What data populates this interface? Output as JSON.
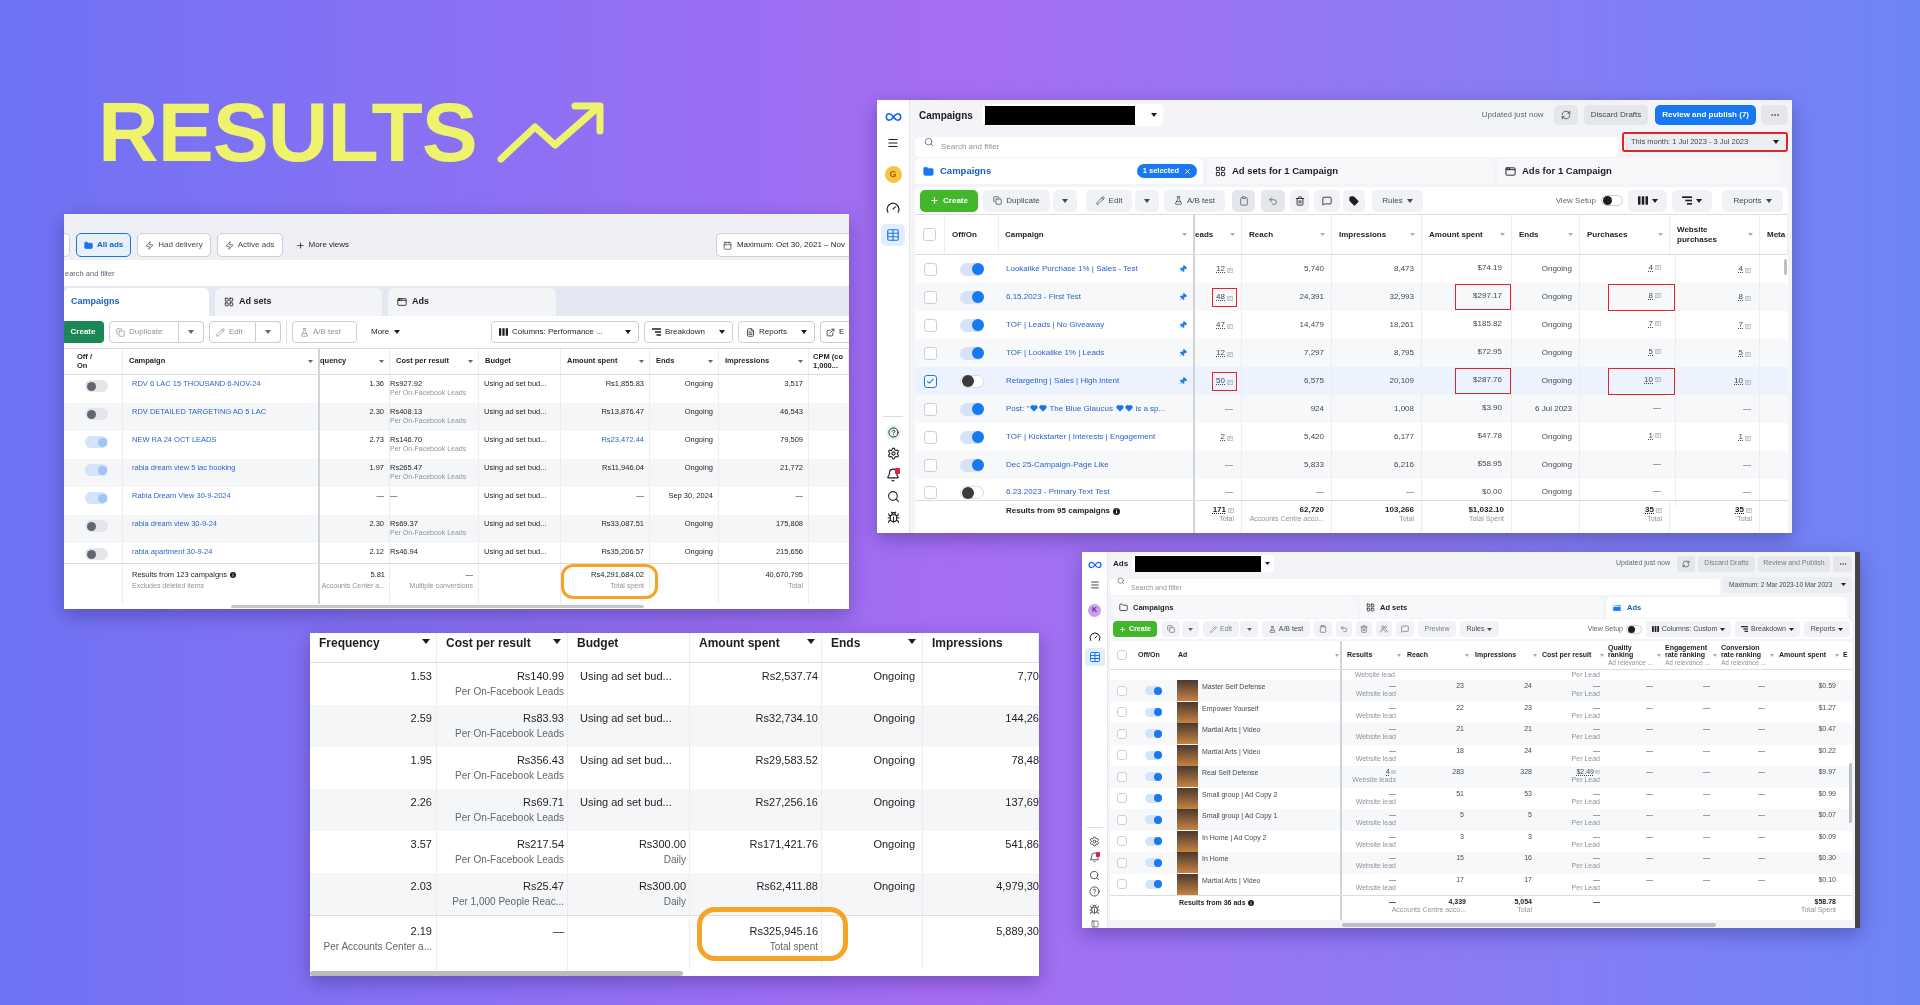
{
  "title": {
    "text": "RESULTS"
  },
  "left_screenshot": {
    "views": [
      {
        "label": "All ads",
        "kind": "folder",
        "selected": true
      },
      {
        "label": "Had delivery",
        "kind": "bolt",
        "selected": false
      },
      {
        "label": "Active ads",
        "kind": "bolt",
        "selected": false
      },
      {
        "label": "More views",
        "kind": "plus",
        "selected": false
      }
    ],
    "date_range": "Maximum: Oct 30, 2021 – Nov",
    "search": {
      "placeholder": "earch and filter"
    },
    "tabs": [
      {
        "label": "Campaigns",
        "selected": true
      },
      {
        "label": "Ad sets",
        "selected": false
      },
      {
        "label": "Ads",
        "selected": false
      }
    ],
    "toolbar": {
      "create": "Create",
      "duplicate": {
        "label": "Duplicate",
        "disabled": true
      },
      "edit": {
        "label": "Edit",
        "disabled": true
      },
      "ab_test": {
        "label": "A/B test",
        "disabled": true
      },
      "more": "More",
      "columns": "Columns: Performance ...",
      "breakdown": "Breakdown",
      "reports": "Reports",
      "export": "E"
    },
    "columns": [
      {
        "label": "Off / On",
        "sortable": false
      },
      {
        "label": "Campaign",
        "sortable": true
      },
      {
        "label": "quency",
        "sortable": true
      },
      {
        "label": "Cost per result",
        "sortable": true
      },
      {
        "label": "Budget",
        "sortable": false
      },
      {
        "label": "Amount spent",
        "sortable": true
      },
      {
        "label": "Ends",
        "sortable": true
      },
      {
        "label": "Impressions",
        "sortable": true
      },
      {
        "label": "CPM (co 1,000...",
        "sortable": false
      }
    ],
    "rows": [
      {
        "on": false,
        "campaign": "RDV 6 LAC 15 THOUSAND 6-NOV-24",
        "frequency": "1.36",
        "cost_per_result": "Rs927.92",
        "cost_note": "Per On-Facebook Leads",
        "budget": "Using ad set bud...",
        "amount_spent": "Rs1,855.83",
        "amount_linked": false,
        "ends": "Ongoing",
        "impressions": "3,517"
      },
      {
        "on": false,
        "campaign": "RDV DETAILED TARGETING AD 5 LAC",
        "frequency": "2.30",
        "cost_per_result": "Rs408.13",
        "cost_note": "Per On-Facebook Leads",
        "budget": "Using ad set bud...",
        "amount_spent": "Rs13,876.47",
        "amount_linked": false,
        "ends": "Ongoing",
        "impressions": "46,543"
      },
      {
        "on": true,
        "campaign": "NEW RA 24 OCT LEADS",
        "frequency": "2.73",
        "cost_per_result": "Rs146.70",
        "cost_note": "Per On-Facebook Leads",
        "budget": "Using ad set bud...",
        "amount_spent": "Rs23,472.44",
        "amount_linked": true,
        "ends": "Ongoing",
        "impressions": "79,509"
      },
      {
        "on": true,
        "campaign": "rabia dream view 5 lac booking",
        "frequency": "1.97",
        "cost_per_result": "Rs265.47",
        "cost_note": "Per On-Facebook Leads",
        "budget": "Using ad set bud...",
        "amount_spent": "Rs11,946.04",
        "amount_linked": false,
        "ends": "Ongoing",
        "impressions": "21,772"
      },
      {
        "on": true,
        "campaign": "Rabia Dream View 30-9-2024",
        "frequency": "—",
        "cost_per_result": "—",
        "budget": "Using ad set bud...",
        "amount_spent": "—",
        "amount_linked": false,
        "ends": "Sep 30, 2024",
        "impressions": "—"
      },
      {
        "on": false,
        "campaign": "rabia dream view 30-9-24",
        "frequency": "2.30",
        "cost_per_result": "Rs69.37",
        "cost_note": "Per On-Facebook Leads",
        "budget": "Using ad set bud...",
        "amount_spent": "Rs33,087.51",
        "amount_linked": false,
        "ends": "Ongoing",
        "impressions": "175,808"
      },
      {
        "on": false,
        "campaign": "rabia apartment 30-9-24",
        "frequency": "2.12",
        "cost_per_result": "Rs46.94",
        "budget": "Using ad set bud...",
        "amount_spent": "Rs35,206.57",
        "amount_linked": false,
        "ends": "Ongoing",
        "impressions": "215,656"
      }
    ],
    "footer": {
      "label": "Results from 123 campaigns",
      "note": "Excludes deleted items",
      "frequency": "5.81",
      "frequency_note": "Accounts Center a...",
      "cost_per_result": "—",
      "cost_note": "Multiple conversions",
      "amount_spent": "Rs4,291,684.02",
      "amount_note": "Total spent",
      "circled": true,
      "impressions": "40,670,795",
      "impressions_note": "Total"
    }
  },
  "top_right_screenshot": {
    "avatar": "G",
    "page_title": "Campaigns",
    "status": "Updated just now",
    "discard": {
      "label": "Discard Drafts",
      "disabled": false
    },
    "publish": {
      "label": "Review and publish (7)",
      "disabled": false
    },
    "search": {
      "placeholder": "Search and filter"
    },
    "date_range": {
      "text": "This month: 1 Jul 2023 - 3 Jul 2023",
      "boxed": true
    },
    "tabs": [
      {
        "label": "Campaigns",
        "selected": true,
        "chip": "1 selected"
      },
      {
        "label": "Ad sets for 1 Campaign",
        "selected": false
      },
      {
        "label": "Ads for 1 Campaign",
        "selected": false
      }
    ],
    "toolbar": {
      "create": "Create",
      "duplicate": {
        "label": "Duplicate",
        "disabled": false
      },
      "edit": {
        "label": "Edit",
        "disabled": false
      },
      "ab_test": {
        "label": "A/B test",
        "disabled": false
      },
      "rules": "Rules",
      "view_setup": {
        "label": "View Setup",
        "on": false
      },
      "reports": "Reports"
    },
    "select_all_checked": false,
    "columns": [
      {
        "label": "Off/On",
        "sortable": false
      },
      {
        "label": "Campaign",
        "sortable": true
      },
      {
        "label": "eads",
        "sortable": true
      },
      {
        "label": "Reach",
        "sortable": true
      },
      {
        "label": "Impressions",
        "sortable": true
      },
      {
        "label": "Amount spent",
        "sortable": true
      },
      {
        "label": "Ends",
        "sortable": true
      },
      {
        "label": "Purchases",
        "sortable": true
      },
      {
        "label": "Website purchases",
        "sortable": true
      },
      {
        "label": "Meta",
        "sortable": false
      }
    ],
    "rows": [
      {
        "selected": false,
        "on": true,
        "campaign": "Lookalike Purchase 1% | Sales - Test",
        "pinned": true,
        "leads": "12",
        "reach": "5,740",
        "impressions": "8,473",
        "amount_spent": "$74.19",
        "ends": "Ongoing",
        "purchases": "4",
        "website_purchases": "4",
        "attribution_icons": true,
        "boxed": false
      },
      {
        "selected": false,
        "on": true,
        "campaign": "6.15.2023 - First Test",
        "pinned": true,
        "leads": "48",
        "reach": "24,391",
        "impressions": "32,993",
        "amount_spent": "$297.17",
        "ends": "Ongoing",
        "purchases": "8",
        "website_purchases": "8",
        "attribution_icons": true,
        "boxed": true
      },
      {
        "selected": false,
        "on": true,
        "campaign": "TOF | Leads | No Giveaway",
        "pinned": true,
        "leads": "47",
        "reach": "14,479",
        "impressions": "18,261",
        "amount_spent": "$185.82",
        "ends": "Ongoing",
        "purchases": "7",
        "website_purchases": "7",
        "attribution_icons": true,
        "boxed": false
      },
      {
        "selected": false,
        "on": true,
        "campaign": "TOF | Lookalike 1% | Leads",
        "pinned": true,
        "leads": "12",
        "reach": "7,297",
        "impressions": "8,795",
        "amount_spent": "$72.95",
        "ends": "Ongoing",
        "purchases": "5",
        "website_purchases": "5",
        "attribution_icons": true,
        "boxed": false
      },
      {
        "selected": true,
        "on": false,
        "campaign": "Retargeting | Sales | High Intent",
        "pinned": true,
        "leads": "50",
        "reach": "6,575",
        "impressions": "20,109",
        "amount_spent": "$287.76",
        "ends": "Ongoing",
        "purchases": "10",
        "website_purchases": "10",
        "attribution_icons": true,
        "boxed": true
      },
      {
        "selected": false,
        "on": true,
        "campaign_parts": [
          {
            "kind": "text",
            "text": "Post: \""
          },
          {
            "kind": "heart"
          },
          {
            "kind": "heart"
          },
          {
            "kind": "text",
            "text": " The Blue Glaucus "
          },
          {
            "kind": "heart"
          },
          {
            "kind": "heart"
          },
          {
            "kind": "text",
            "text": " is a sp..."
          }
        ],
        "pinned": false,
        "leads": "—",
        "reach": "924",
        "impressions": "1,008",
        "amount_spent": "$3.90",
        "ends": "6 Jul 2023",
        "purchases": "—",
        "website_purchases": "—",
        "attribution_icons": false,
        "boxed": false
      },
      {
        "selected": false,
        "on": true,
        "campaign": "TOF | Kickstarter | Interests | Engagement",
        "pinned": false,
        "leads": "2",
        "reach": "5,420",
        "impressions": "6,177",
        "amount_spent": "$47.78",
        "ends": "Ongoing",
        "purchases": "1",
        "website_purchases": "1",
        "attribution_icons": true,
        "boxed": false
      },
      {
        "selected": false,
        "on": true,
        "campaign": "Dec 25-Campaign-Page Like",
        "pinned": false,
        "leads": "—",
        "reach": "5,833",
        "impressions": "6,216",
        "amount_spent": "$58.95",
        "ends": "Ongoing",
        "purchases": "—",
        "website_purchases": "—",
        "attribution_icons": false,
        "boxed": false
      },
      {
        "selected": false,
        "on": false,
        "campaign": "6.23.2023 - Primary Text Test",
        "pinned": false,
        "leads": "—",
        "reach": "—",
        "impressions": "—",
        "amount_spent": "$0.00",
        "ends": "Ongoing",
        "purchases": "—",
        "website_purchases": "—",
        "attribution_icons": false,
        "boxed": false
      }
    ],
    "footer": {
      "label": "Results from 95 campaigns",
      "leads": "171",
      "leads_note": "Total",
      "reach": "62,720",
      "reach_note": "Accounts Centre acco...",
      "impressions": "103,266",
      "impressions_note": "Total",
      "amount_spent": "$1,032.10",
      "amount_note": "Total Spent",
      "purchases": "35",
      "purchases_note": "Total",
      "website_purchases": "35",
      "website_purchases_note": "Total"
    }
  },
  "bottom_screenshot": {
    "columns": [
      {
        "label": "Frequency",
        "sortable": true
      },
      {
        "label": "Cost per result",
        "sortable": true
      },
      {
        "label": "Budget",
        "sortable": false
      },
      {
        "label": "Amount spent",
        "sortable": true
      },
      {
        "label": "Ends",
        "sortable": true
      },
      {
        "label": "Impressions",
        "sortable": false
      }
    ],
    "rows": [
      {
        "frequency": "1.53",
        "cost_per_result": "Rs140.99",
        "cost_note": "Per On-Facebook Leads",
        "budget": {
          "kind": "ad_set",
          "text": "Using ad set bud..."
        },
        "amount_spent": "Rs2,537.74",
        "ends": "Ongoing",
        "impressions": "7,70"
      },
      {
        "frequency": "2.59",
        "cost_per_result": "Rs83.93",
        "cost_note": "Per On-Facebook Leads",
        "budget": {
          "kind": "ad_set",
          "text": "Using ad set bud..."
        },
        "amount_spent": "Rs32,734.10",
        "ends": "Ongoing",
        "impressions": "144,26"
      },
      {
        "frequency": "1.95",
        "cost_per_result": "Rs356.43",
        "cost_note": "Per On-Facebook Leads",
        "budget": {
          "kind": "ad_set",
          "text": "Using ad set bud..."
        },
        "amount_spent": "Rs29,583.52",
        "ends": "Ongoing",
        "impressions": "78,48"
      },
      {
        "frequency": "2.26",
        "cost_per_result": "Rs69.71",
        "cost_note": "Per On-Facebook Leads",
        "budget": {
          "kind": "ad_set",
          "text": "Using ad set bud..."
        },
        "amount_spent": "Rs27,256.16",
        "ends": "Ongoing",
        "impressions": "137,69"
      },
      {
        "frequency": "3.57",
        "cost_per_result": "Rs217.54",
        "cost_note": "Per On-Facebook Leads",
        "budget": {
          "kind": "daily",
          "text": "Rs300.00",
          "note": "Daily"
        },
        "amount_spent": "Rs171,421.76",
        "ends": "Ongoing",
        "impressions": "541,86"
      },
      {
        "frequency": "2.03",
        "cost_per_result": "Rs25.47",
        "cost_note": "Per 1,000 People Reac...",
        "budget": {
          "kind": "daily",
          "text": "Rs300.00",
          "note": "Daily"
        },
        "amount_spent": "Rs62,411.88",
        "ends": "Ongoing",
        "impressions": "4,979,30"
      }
    ],
    "footer": {
      "frequency": "2.19",
      "frequency_note": "Per Accounts Center a...",
      "cost_per_result": "—",
      "amount_spent": "Rs325,945.16",
      "amount_note": "Total spent",
      "circled": true,
      "impressions": "5,889,30"
    }
  },
  "bottom_right_screenshot": {
    "avatar": "K",
    "page_title": "Ads",
    "status": "Updated just now",
    "discard": {
      "label": "Discard Drafts",
      "disabled": true
    },
    "publish": {
      "label": "Review and Publish",
      "disabled": true
    },
    "search": {
      "placeholder": "Search and filter"
    },
    "date_range": {
      "text": "Maximum: 2 Mar 2023-10 Mar 2023",
      "boxed": false
    },
    "tabs": [
      {
        "label": "Campaigns",
        "selected": false
      },
      {
        "label": "Ad sets",
        "selected": false
      },
      {
        "label": "Ads",
        "selected": true
      }
    ],
    "toolbar": {
      "create": "Create",
      "edit": {
        "label": "Edit",
        "disabled": true
      },
      "ab_test": {
        "label": "A/B test",
        "disabled": false
      },
      "preview": {
        "label": "Preview",
        "disabled": true
      },
      "rules": "Rules",
      "view_setup": {
        "label": "View Setup",
        "on": false
      },
      "columns": "Columns: Custom",
      "breakdown": "Breakdown",
      "reports": "Reports"
    },
    "select_all_checked": false,
    "columns": [
      {
        "label": "Off/On",
        "sortable": false
      },
      {
        "label": "Ad",
        "sortable": true
      },
      {
        "label": "Results",
        "sortable": true
      },
      {
        "label": "Reach",
        "sortable": true
      },
      {
        "label": "Impressions",
        "sortable": true
      },
      {
        "label": "Cost per result",
        "sortable": true
      },
      {
        "label": "Quality ranking",
        "note": "Ad relevance ...",
        "sortable": true
      },
      {
        "label": "Engagement rate ranking",
        "note": "Ad relevance ...",
        "sortable": true
      },
      {
        "label": "Conversion rate ranking",
        "note": "Ad relevance ...",
        "sortable": true
      },
      {
        "label": "Amount spent",
        "sortable": true
      },
      {
        "label": "E",
        "sortable": false
      }
    ],
    "partial_row": {
      "result_note": "Website lead",
      "cost_note": "Per Lead"
    },
    "rows": [
      {
        "selected": false,
        "on": true,
        "ad": "Master Self Defense",
        "result": "—",
        "result_note": "Website lead",
        "reach": "23",
        "impressions": "24",
        "cost_per_result": "—",
        "cost_note": "Per Lead",
        "quality": "—",
        "engagement": "—",
        "conversion": "—",
        "amount_spent": "$0.59",
        "attribution_icons": false
      },
      {
        "selected": false,
        "on": true,
        "ad": "Empower Yourself",
        "result": "—",
        "result_note": "Website lead",
        "reach": "22",
        "impressions": "23",
        "cost_per_result": "—",
        "cost_note": "Per Lead",
        "quality": "—",
        "engagement": "—",
        "conversion": "—",
        "amount_spent": "$1.27",
        "attribution_icons": false
      },
      {
        "selected": false,
        "on": true,
        "ad": "Martial Arts | Video",
        "result": "—",
        "result_note": "Website lead",
        "reach": "21",
        "impressions": "21",
        "cost_per_result": "—",
        "cost_note": "Per Lead",
        "quality": "—",
        "engagement": "—",
        "conversion": "—",
        "amount_spent": "$0.47",
        "attribution_icons": false
      },
      {
        "selected": false,
        "on": true,
        "ad": "Martial Arts | Video",
        "result": "—",
        "result_note": "Website lead",
        "reach": "18",
        "impressions": "24",
        "cost_per_result": "—",
        "cost_note": "Per Lead",
        "quality": "—",
        "engagement": "—",
        "conversion": "—",
        "amount_spent": "$0.22",
        "attribution_icons": false
      },
      {
        "selected": false,
        "on": true,
        "ad": "Real Self Defense",
        "result": "4",
        "result_note": "Website leads",
        "reach": "283",
        "impressions": "328",
        "cost_per_result": "$2.49",
        "cost_note": "Per Lead",
        "quality": "—",
        "engagement": "—",
        "conversion": "—",
        "amount_spent": "$9.97",
        "attribution_icons": true
      },
      {
        "selected": false,
        "on": true,
        "ad": "Small group | Ad Copy 2",
        "result": "—",
        "result_note": "Website lead",
        "reach": "51",
        "impressions": "53",
        "cost_per_result": "—",
        "cost_note": "Per Lead",
        "quality": "—",
        "engagement": "—",
        "conversion": "—",
        "amount_spent": "$0.99",
        "attribution_icons": false
      },
      {
        "selected": false,
        "on": true,
        "ad": "Small group | Ad Copy 1",
        "result": "—",
        "result_note": "Website lead",
        "reach": "5",
        "impressions": "5",
        "cost_per_result": "—",
        "cost_note": "Per Lead",
        "quality": "—",
        "engagement": "—",
        "conversion": "—",
        "amount_spent": "$0.07",
        "attribution_icons": false
      },
      {
        "selected": false,
        "on": true,
        "ad": "In Home | Ad Copy 2",
        "result": "—",
        "result_note": "Website lead",
        "reach": "3",
        "impressions": "3",
        "cost_per_result": "—",
        "cost_note": "Per Lead",
        "quality": "—",
        "engagement": "—",
        "conversion": "—",
        "amount_spent": "$0.09",
        "attribution_icons": false
      },
      {
        "selected": false,
        "on": true,
        "ad": "In Home",
        "result": "—",
        "result_note": "Website lead",
        "reach": "15",
        "impressions": "16",
        "cost_per_result": "—",
        "cost_note": "Per Lead",
        "quality": "—",
        "engagement": "—",
        "conversion": "—",
        "amount_spent": "$0.30",
        "attribution_icons": false
      },
      {
        "selected": false,
        "on": true,
        "ad": "Martial Arts | Video",
        "result": "—",
        "result_note": "Website lead",
        "reach": "17",
        "impressions": "17",
        "cost_per_result": "—",
        "cost_note": "Per Lead",
        "quality": "—",
        "engagement": "—",
        "conversion": "—",
        "amount_spent": "$0.10",
        "attribution_icons": false
      }
    ],
    "footer": {
      "label": "Results from 36 ads",
      "result": "—",
      "reach": "4,339",
      "reach_note": "Accounts Centre acco...",
      "impressions": "5,054",
      "impressions_note": "Total",
      "cost_per_result": "—",
      "amount_spent": "$58.78",
      "amount_note": "Total Spent"
    }
  }
}
